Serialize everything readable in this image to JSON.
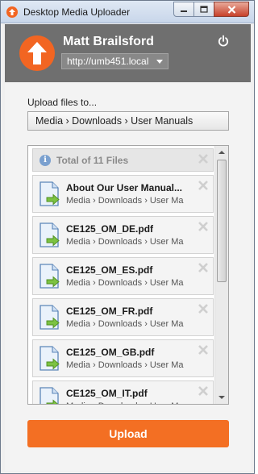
{
  "window": {
    "title": "Desktop Media Uploader"
  },
  "header": {
    "user_name": "Matt Brailsford",
    "server": "http://umb451.local"
  },
  "upload": {
    "label": "Upload files to...",
    "folder_path": "Media › Downloads › User Manuals",
    "button_label": "Upload"
  },
  "files": {
    "total_label": "Total of 11 Files",
    "items": [
      {
        "name": "About Our User Manual...",
        "path": "Media › Downloads › User Ma"
      },
      {
        "name": "CE125_OM_DE.pdf",
        "path": "Media › Downloads › User Ma"
      },
      {
        "name": "CE125_OM_ES.pdf",
        "path": "Media › Downloads › User Ma"
      },
      {
        "name": "CE125_OM_FR.pdf",
        "path": "Media › Downloads › User Ma"
      },
      {
        "name": "CE125_OM_GB.pdf",
        "path": "Media › Downloads › User Ma"
      },
      {
        "name": "CE125_OM_IT.pdf",
        "path": "Media › Downloads › User Ma"
      }
    ]
  },
  "colors": {
    "accent": "#f36f23",
    "header_bg": "#6f6f6f"
  },
  "icons": [
    "app-logo-icon",
    "minimize-icon",
    "maximize-icon",
    "close-icon",
    "power-icon",
    "chevron-down-icon",
    "info-icon",
    "remove-icon",
    "document-icon",
    "scroll-up-icon",
    "scroll-down-icon"
  ]
}
